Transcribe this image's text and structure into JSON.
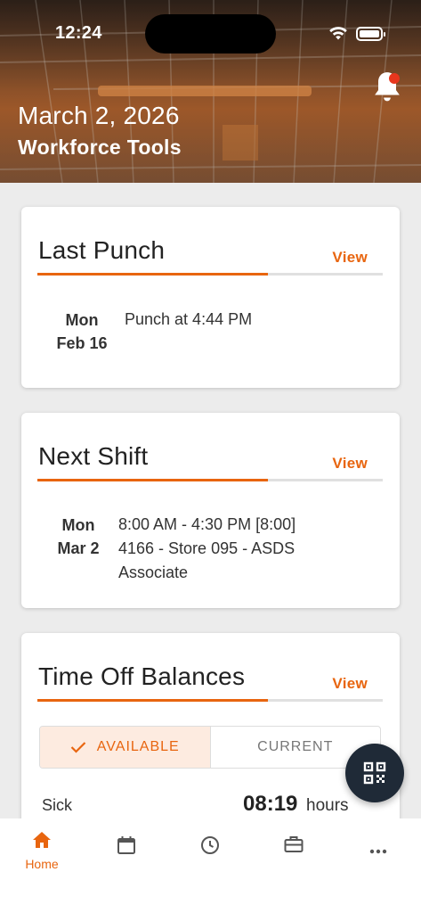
{
  "status_bar": {
    "time": "12:24"
  },
  "header": {
    "date": "March 2, 2026",
    "subtitle": "Workforce Tools",
    "notification_dot": true
  },
  "cards": {
    "last_punch": {
      "title": "Last Punch",
      "link": "View",
      "day": "Mon",
      "date": "Feb 16",
      "detail": "Punch at 4:44 PM"
    },
    "next_shift": {
      "title": "Next Shift",
      "link": "View",
      "day": "Mon",
      "date": "Mar 2",
      "time": "8:00 AM - 4:30 PM [8:00]",
      "location": "4166 - Store 095 - ASDS",
      "role": "Associate"
    },
    "time_off": {
      "title": "Time Off Balances",
      "link": "View",
      "tabs": [
        "AVAILABLE",
        "CURRENT"
      ],
      "selected_tab": "AVAILABLE",
      "balance_label": "Sick",
      "balance_value": "08:19",
      "balance_unit": "hours"
    }
  },
  "bottom_nav": {
    "items": [
      {
        "icon": "home-icon",
        "label": "Home",
        "active": true
      },
      {
        "icon": "calendar-icon",
        "label": ""
      },
      {
        "icon": "clock-icon",
        "label": ""
      },
      {
        "icon": "briefcase-icon",
        "label": ""
      },
      {
        "icon": "more-icon",
        "label": ""
      }
    ]
  },
  "colors": {
    "accent": "#e8650f",
    "fab": "#1f2a37",
    "notification": "#e8361d"
  }
}
